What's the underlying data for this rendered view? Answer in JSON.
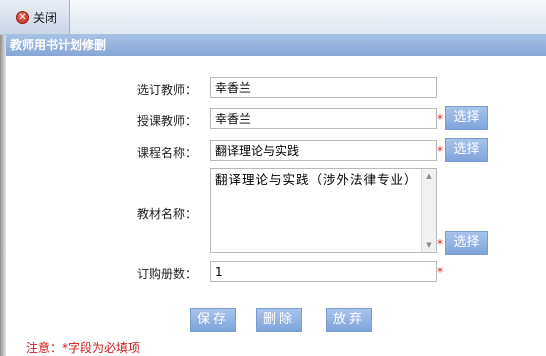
{
  "toolbar": {
    "close_label": "关闭"
  },
  "title_bar": {
    "title": "教师用书计划修删"
  },
  "form": {
    "ordering_teacher": {
      "label": "选订教师：",
      "value": "幸香兰"
    },
    "teaching_teacher": {
      "label": "授课教师：",
      "value": "幸香兰",
      "required": "*",
      "select_label": "选择"
    },
    "course_name": {
      "label": "课程名称：",
      "value": "翻译理论与实践",
      "required": "*",
      "select_label": "选择"
    },
    "textbook_name": {
      "label": "教材名称：",
      "value": "翻译理论与实践（涉外法律专业）",
      "required": "*",
      "select_label": "选择"
    },
    "order_quantity": {
      "label": "订购册数：",
      "value": "1",
      "required": "*"
    }
  },
  "actions": {
    "save": "保存",
    "delete": "删除",
    "cancel": "放弃"
  },
  "note": "注意：*字段为必填项",
  "colors": {
    "title_bar": "#86a7d6",
    "button": "#7ea4dc",
    "required": "#e02020",
    "note": "#d01818"
  }
}
